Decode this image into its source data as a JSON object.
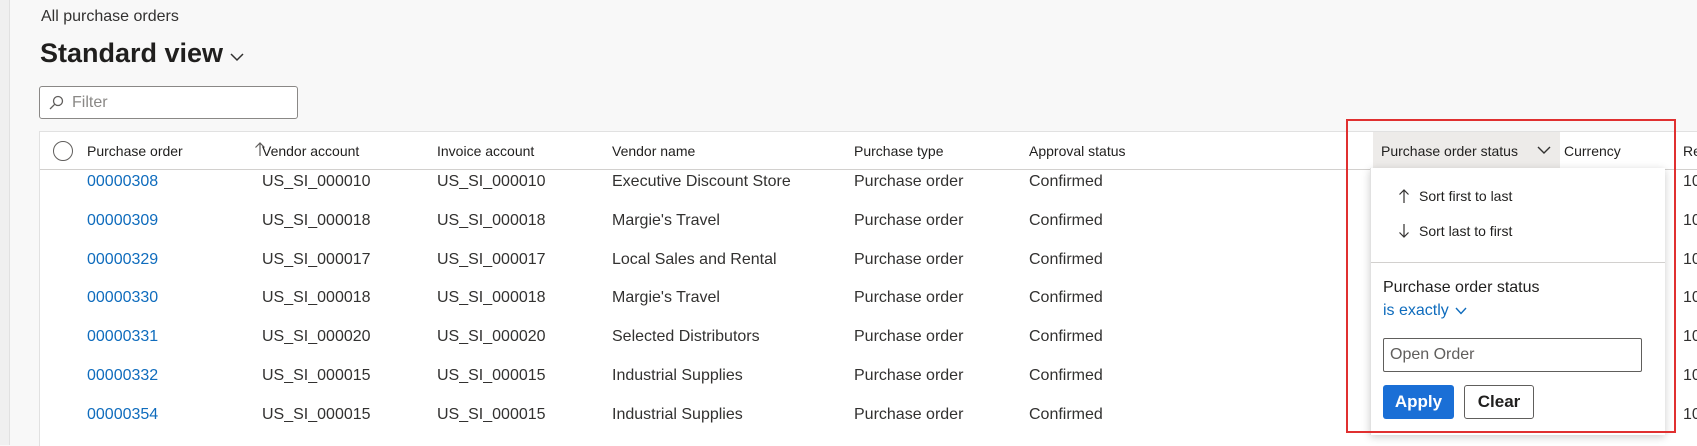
{
  "breadcrumb": "All purchase orders",
  "view": {
    "title": "Standard view"
  },
  "filter": {
    "placeholder": "Filter",
    "value": ""
  },
  "grid": {
    "columns": [
      "Purchase order",
      "Vendor account",
      "Invoice account",
      "Vendor name",
      "Purchase type",
      "Approval status",
      "Purchase order status",
      "Currency",
      "Re"
    ],
    "rows": [
      {
        "po": "00000308",
        "vendor": "US_SI_000010",
        "invoice": "US_SI_000010",
        "name": "Executive Discount Store",
        "type": "Purchase order",
        "approval": "Confirmed",
        "extra": "10"
      },
      {
        "po": "00000309",
        "vendor": "US_SI_000018",
        "invoice": "US_SI_000018",
        "name": "Margie's Travel",
        "type": "Purchase order",
        "approval": "Confirmed",
        "extra": "10"
      },
      {
        "po": "00000329",
        "vendor": "US_SI_000017",
        "invoice": "US_SI_000017",
        "name": "Local Sales and Rental",
        "type": "Purchase order",
        "approval": "Confirmed",
        "extra": "10"
      },
      {
        "po": "00000330",
        "vendor": "US_SI_000018",
        "invoice": "US_SI_000018",
        "name": "Margie's Travel",
        "type": "Purchase order",
        "approval": "Confirmed",
        "extra": "10"
      },
      {
        "po": "00000331",
        "vendor": "US_SI_000020",
        "invoice": "US_SI_000020",
        "name": "Selected Distributors",
        "type": "Purchase order",
        "approval": "Confirmed",
        "extra": "10"
      },
      {
        "po": "00000332",
        "vendor": "US_SI_000015",
        "invoice": "US_SI_000015",
        "name": "Industrial Supplies",
        "type": "Purchase order",
        "approval": "Confirmed",
        "extra": "10"
      },
      {
        "po": "00000354",
        "vendor": "US_SI_000015",
        "invoice": "US_SI_000015",
        "name": "Industrial Supplies",
        "type": "Purchase order",
        "approval": "Confirmed",
        "extra": "10"
      }
    ]
  },
  "dropdown": {
    "sort_asc": "Sort first to last",
    "sort_desc": "Sort last to first",
    "filter_label": "Purchase order status",
    "operator": "is exactly",
    "value": "Open Order",
    "apply": "Apply",
    "clear": "Clear"
  },
  "colors": {
    "link": "#0f6cbd",
    "primary": "#1a6fd6",
    "highlight": "#e03030"
  },
  "icons": [
    "search-icon",
    "chevron-down-icon",
    "sort-ascending-icon",
    "arrow-up-icon",
    "arrow-down-icon"
  ]
}
